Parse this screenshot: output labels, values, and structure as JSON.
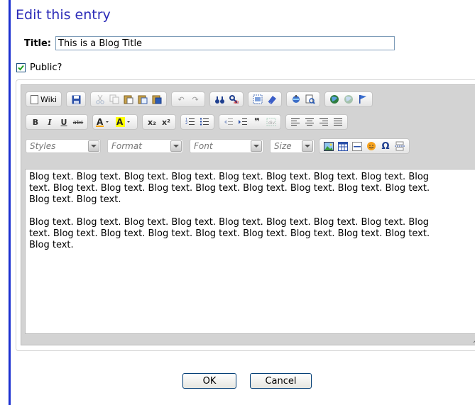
{
  "page": {
    "heading": "Edit this entry",
    "title_label": "Title:",
    "title_value": "This is a Blog Title",
    "public_label": "Public?",
    "public_checked": true
  },
  "editor": {
    "wiki_label": "Wiki",
    "toolbar_row1_icons": [
      "save-icon",
      "cut-icon",
      "copy-icon",
      "paste-icon",
      "paste-text-icon",
      "paste-word-icon",
      "undo-icon",
      "redo-icon",
      "find-icon",
      "replace-icon",
      "select-all-icon",
      "remove-format-icon",
      "spell-check-icon",
      "preview-icon",
      "link-icon",
      "unlink-icon",
      "anchor-icon"
    ],
    "bold": "B",
    "italic": "I",
    "underline": "U",
    "strike": "abc",
    "subscript": "x₂",
    "superscript": "x²",
    "styles_label": "Styles",
    "format_label": "Format",
    "font_label": "Font",
    "size_label": "Size",
    "content_paragraphs": [
      "Blog text. Blog text. Blog text. Blog text. Blog text. Blog text. Blog text. Blog text. Blog text. Blog text. Blog text. Blog text. Blog text. Blog text. Blog text. Blog text. Blog text. Blog text. Blog text.",
      "Blog text. Blog text. Blog text. Blog text. Blog text. Blog text. Blog text. Blog text. Blog text. Blog text. Blog text. Blog text. Blog text. Blog text. Blog text. Blog text. Blog text. Blog text."
    ]
  },
  "buttons": {
    "ok": "OK",
    "cancel": "Cancel"
  },
  "colors": {
    "accent_bar": "#1a2fd0",
    "heading": "#2b2bb8",
    "editor_bg": "#d3d3d3"
  }
}
